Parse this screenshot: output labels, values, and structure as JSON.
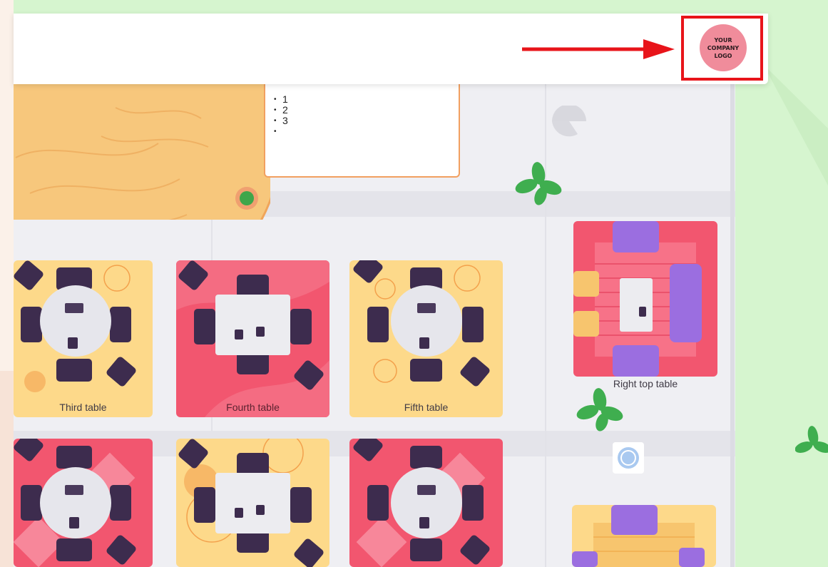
{
  "header": {
    "logo_line1": "YOUR",
    "logo_line2": "COMPANY",
    "logo_line3": "LOGO"
  },
  "note": {
    "items": [
      "1",
      "2",
      "3",
      ""
    ]
  },
  "tables": {
    "third": "Third table",
    "fourth": "Fourth table",
    "fifth": "Fifth table",
    "right_top": "Right top table"
  },
  "colors": {
    "accent_red": "#e8141a",
    "table_red": "#f2566f",
    "table_yellow": "#fdd98a",
    "chair": "#3d2c4e",
    "sofa": "#9b6ee0",
    "background_green": "#d6f5cf"
  },
  "icons": [
    "arrow-right-icon",
    "plant-icon",
    "clock-icon",
    "lamp-icon"
  ]
}
